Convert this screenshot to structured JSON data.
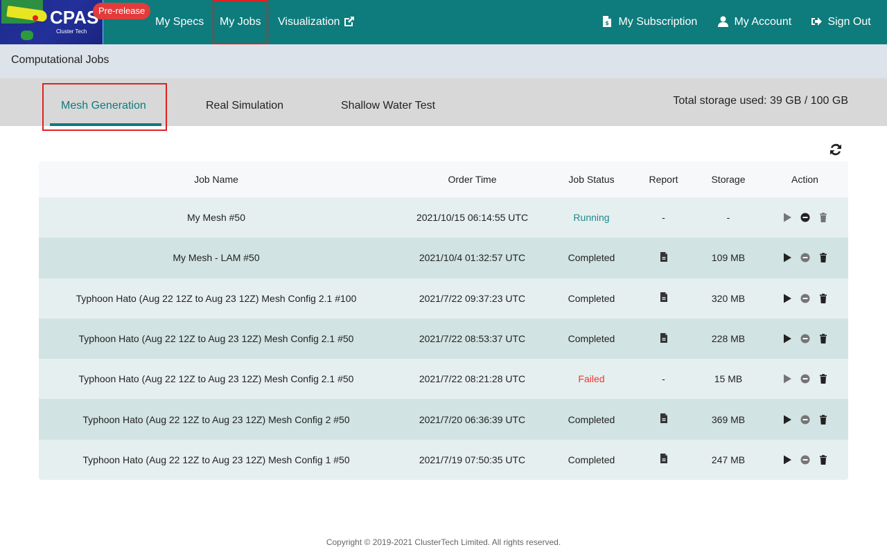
{
  "header": {
    "logo_title": "CPAS",
    "logo_subtitle": "Cluster Tech",
    "badge": "Pre-release",
    "nav_left": [
      {
        "label": "My Specs"
      },
      {
        "label": "My Jobs",
        "active": true
      },
      {
        "label": "Visualization",
        "icon": "external-link-icon"
      }
    ],
    "nav_right": [
      {
        "label": "My Subscription",
        "icon": "invoice-icon"
      },
      {
        "label": "My Account",
        "icon": "user-icon"
      },
      {
        "label": "Sign Out",
        "icon": "sign-out-icon"
      }
    ]
  },
  "page": {
    "title": "Computational Jobs"
  },
  "tabs": [
    {
      "label": "Mesh Generation",
      "active": true
    },
    {
      "label": "Real Simulation"
    },
    {
      "label": "Shallow Water Test"
    }
  ],
  "storage_text": "Total storage used: 39 GB / 100 GB",
  "table": {
    "columns": [
      "Job Name",
      "Order Time",
      "Job Status",
      "Report",
      "Storage",
      "Action"
    ],
    "rows": [
      {
        "name": "My Mesh #50",
        "time": "2021/10/15 06:14:55 UTC",
        "status": "Running",
        "report": "-",
        "storage": "-",
        "play_enabled": false,
        "stop_enabled": true,
        "delete_enabled": false
      },
      {
        "name": "My Mesh - LAM #50",
        "time": "2021/10/4 01:32:57 UTC",
        "status": "Completed",
        "report": "file-icon",
        "storage": "109 MB",
        "play_enabled": true,
        "stop_enabled": false,
        "delete_enabled": true
      },
      {
        "name": "Typhoon Hato (Aug 22 12Z to Aug 23 12Z) Mesh Config 2.1 #100",
        "time": "2021/7/22 09:37:23 UTC",
        "status": "Completed",
        "report": "file-icon",
        "storage": "320 MB",
        "play_enabled": true,
        "stop_enabled": false,
        "delete_enabled": true
      },
      {
        "name": "Typhoon Hato (Aug 22 12Z to Aug 23 12Z) Mesh Config 2.1 #50",
        "time": "2021/7/22 08:53:37 UTC",
        "status": "Completed",
        "report": "file-icon",
        "storage": "228 MB",
        "play_enabled": true,
        "stop_enabled": false,
        "delete_enabled": true
      },
      {
        "name": "Typhoon Hato (Aug 22 12Z to Aug 23 12Z) Mesh Config 2.1 #50",
        "time": "2021/7/22 08:21:28 UTC",
        "status": "Failed",
        "report": "-",
        "storage": "15 MB",
        "play_enabled": false,
        "stop_enabled": false,
        "delete_enabled": true
      },
      {
        "name": "Typhoon Hato (Aug 22 12Z to Aug 23 12Z) Mesh Config 2 #50",
        "time": "2021/7/20 06:36:39 UTC",
        "status": "Completed",
        "report": "file-icon",
        "storage": "369 MB",
        "play_enabled": true,
        "stop_enabled": false,
        "delete_enabled": true
      },
      {
        "name": "Typhoon Hato (Aug 22 12Z to Aug 23 12Z) Mesh Config 1 #50",
        "time": "2021/7/19 07:50:35 UTC",
        "status": "Completed",
        "report": "file-icon",
        "storage": "247 MB",
        "play_enabled": true,
        "stop_enabled": false,
        "delete_enabled": true
      }
    ]
  },
  "colors": {
    "brand": "#0e7b7c",
    "running": "#1a8a8a",
    "failed": "#e53935",
    "badge": "#e33b3b",
    "icon_enabled": "#222222",
    "icon_disabled": "#757575"
  },
  "footer": "Copyright © 2019-2021 ClusterTech Limited. All rights reserved."
}
